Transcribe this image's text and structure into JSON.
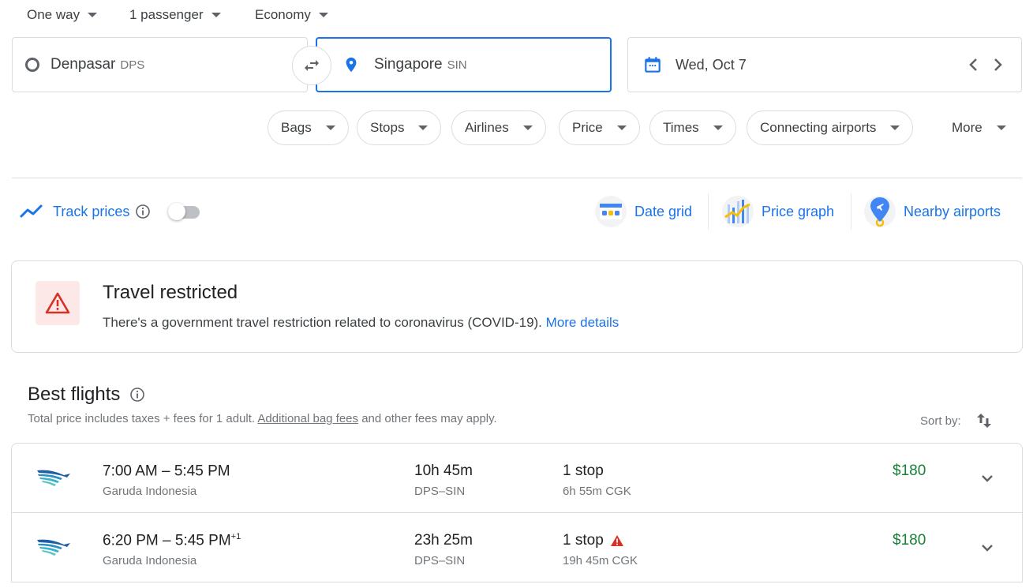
{
  "trip_options": {
    "trip_type": "One way",
    "passengers": "1 passenger",
    "cabin_class": "Economy"
  },
  "search": {
    "origin": {
      "city": "Denpasar",
      "code": "DPS"
    },
    "destination": {
      "city": "Singapore",
      "code": "SIN"
    },
    "date": "Wed, Oct 7"
  },
  "filters": [
    "Bags",
    "Stops",
    "Airlines",
    "Price",
    "Times",
    "Connecting airports",
    "More"
  ],
  "tracking": {
    "label": "Track prices",
    "enabled": false
  },
  "tools": {
    "date_grid": "Date grid",
    "price_graph": "Price graph",
    "nearby_airports": "Nearby airports"
  },
  "alert": {
    "title": "Travel restricted",
    "description": "There's a government travel restriction related to coronavirus (COVID-19).",
    "link": "More details"
  },
  "best_flights": {
    "title": "Best flights",
    "subtitle_before": "Total price includes taxes + fees for 1 adult.",
    "subtitle_link": "Additional bag fees",
    "subtitle_after": "and other fees may apply.",
    "sort_label": "Sort by:"
  },
  "flights": [
    {
      "times": "7:00 AM – 5:45 PM",
      "day_offset": "",
      "airline": "Garuda Indonesia",
      "duration": "10h 45m",
      "route": "DPS–SIN",
      "stops": "1 stop",
      "warning": false,
      "layover": "6h 55m CGK",
      "price": "$180"
    },
    {
      "times": "6:20 PM – 5:45 PM",
      "day_offset": "+1",
      "airline": "Garuda Indonesia",
      "duration": "23h 25m",
      "route": "DPS–SIN",
      "stops": "1 stop",
      "warning": true,
      "layover": "19h 45m CGK",
      "price": "$180"
    }
  ],
  "colors": {
    "accent": "#1a73e8",
    "price": "#188038",
    "warning": "#d93025"
  }
}
